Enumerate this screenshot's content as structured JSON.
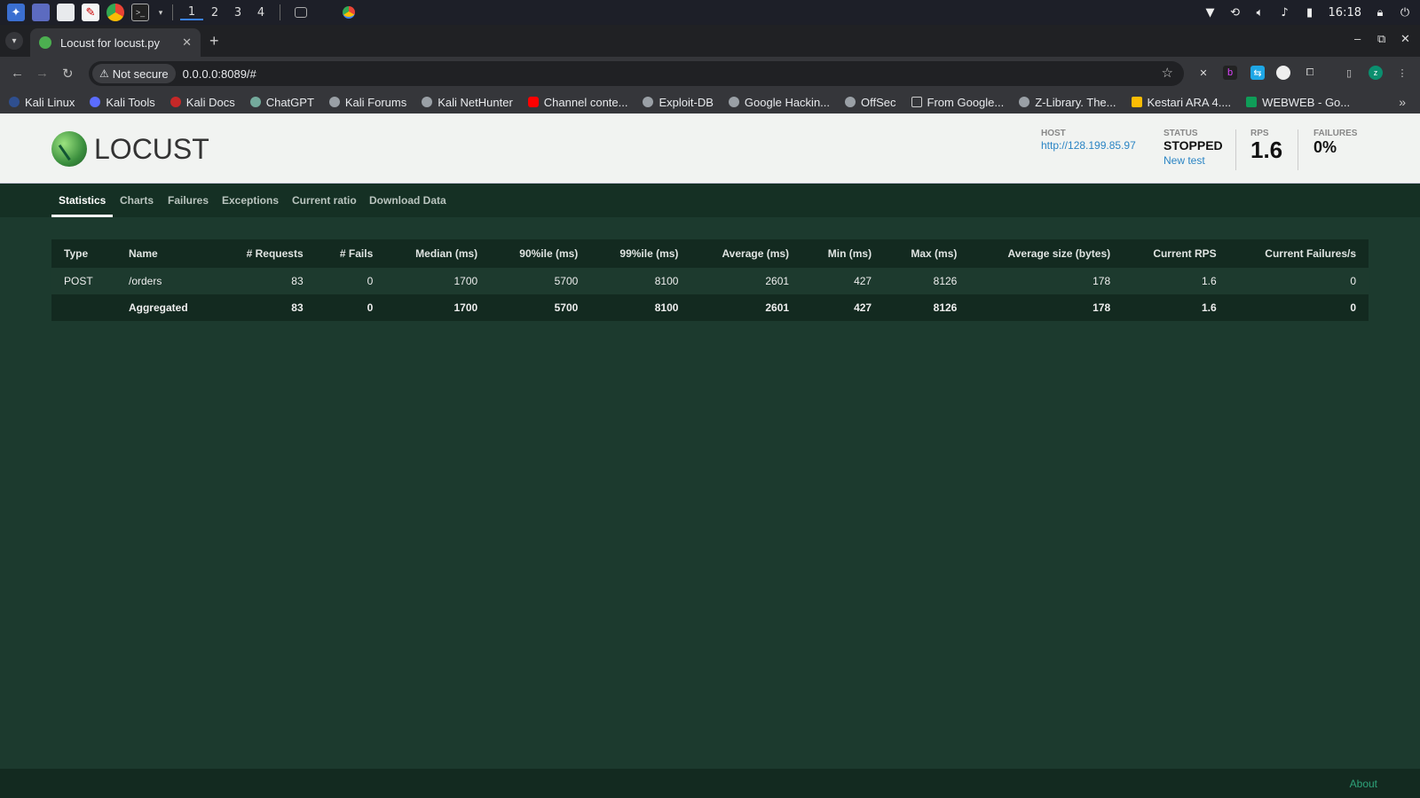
{
  "os": {
    "workspaces": [
      "1",
      "2",
      "3",
      "4"
    ],
    "clock": "16:18"
  },
  "browser": {
    "tab_title": "Locust for locust.py",
    "security_label": "Not secure",
    "url": "0.0.0.0:8089/#",
    "bookmarks": [
      {
        "label": "Kali Linux",
        "color": "#2f4f8f"
      },
      {
        "label": "Kali Tools",
        "color": "#5b6cff"
      },
      {
        "label": "Kali Docs",
        "color": "#c62828"
      },
      {
        "label": "ChatGPT",
        "color": "#74aa9c"
      },
      {
        "label": "Kali Forums",
        "color": "#9aa0a6"
      },
      {
        "label": "Kali NetHunter",
        "color": "#9aa0a6"
      },
      {
        "label": "Channel conte...",
        "color": "#ff0000"
      },
      {
        "label": "Exploit-DB",
        "color": "#9aa0a6"
      },
      {
        "label": "Google Hackin...",
        "color": "#9aa0a6"
      },
      {
        "label": "OffSec",
        "color": "#9aa0a6"
      },
      {
        "label": "From Google...",
        "color": "#9aa0a6"
      },
      {
        "label": "Z-Library. The...",
        "color": "#9aa0a6"
      },
      {
        "label": "Kestari ARA 4....",
        "color": "#fbbc04"
      },
      {
        "label": "WEBWEB - Go...",
        "color": "#0f9d58"
      }
    ]
  },
  "header": {
    "logo_text": "LOCUST",
    "host_label": "HOST",
    "host_value": "http://128.199.85.97",
    "status_label": "STATUS",
    "status_value": "STOPPED",
    "new_test": "New test",
    "rps_label": "RPS",
    "rps_value": "1.6",
    "failures_label": "FAILURES",
    "failures_value": "0%"
  },
  "nav": {
    "tabs": [
      "Statistics",
      "Charts",
      "Failures",
      "Exceptions",
      "Current ratio",
      "Download Data"
    ],
    "active": "Statistics"
  },
  "table": {
    "headers": [
      "Type",
      "Name",
      "# Requests",
      "# Fails",
      "Median (ms)",
      "90%ile (ms)",
      "99%ile (ms)",
      "Average (ms)",
      "Min (ms)",
      "Max (ms)",
      "Average size (bytes)",
      "Current RPS",
      "Current Failures/s"
    ],
    "rows": [
      [
        "POST",
        "/orders",
        "83",
        "0",
        "1700",
        "5700",
        "8100",
        "2601",
        "427",
        "8126",
        "178",
        "1.6",
        "0"
      ]
    ],
    "total": [
      "",
      "Aggregated",
      "83",
      "0",
      "1700",
      "5700",
      "8100",
      "2601",
      "427",
      "8126",
      "178",
      "1.6",
      "0"
    ]
  },
  "footer": {
    "about": "About"
  }
}
